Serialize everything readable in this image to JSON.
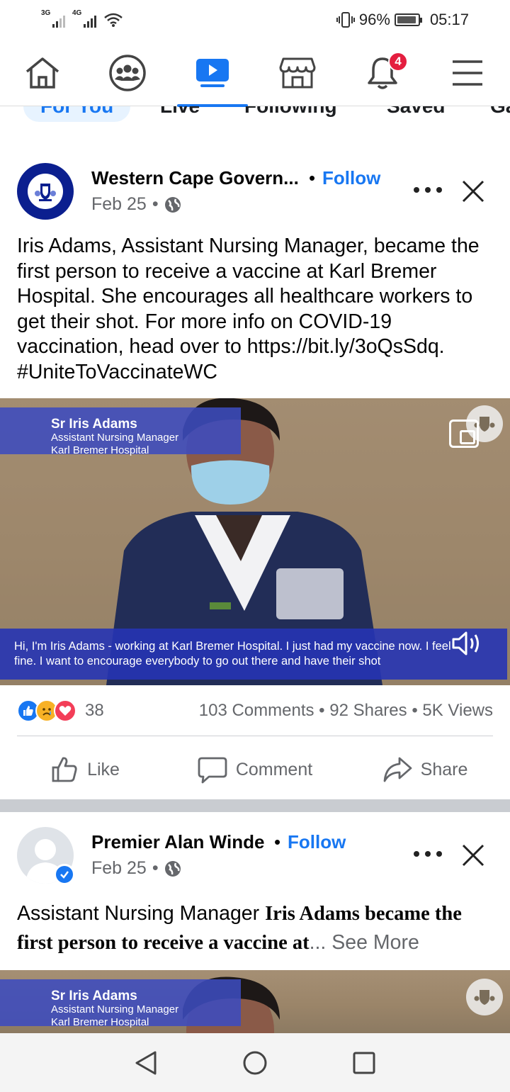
{
  "status_bar": {
    "signal1": "3G",
    "signal2": "4G",
    "battery": "96%",
    "time": "05:17"
  },
  "nav": {
    "notifications_badge": "4",
    "active": "watch"
  },
  "tabs": [
    "For You",
    "Live",
    "Following",
    "Saved",
    "Ga"
  ],
  "posts": [
    {
      "author": "Western Cape Govern...",
      "follow_sep": "•",
      "follow": "Follow",
      "date": "Feb 25",
      "meta_sep": "•",
      "text": "Iris Adams, Assistant Nursing Manager, became the first person to receive a vaccine at Karl Bremer Hospital. She encourages all healthcare workers to get their shot. For more info on COVID-19 vaccination, head over to https://bit.ly/3oQsSdq. #UniteToVaccinateWC",
      "video": {
        "lower_third_name": "Sr Iris Adams",
        "lower_third_title": "Assistant Nursing Manager",
        "lower_third_place": "Karl Bremer Hospital",
        "caption_line1": "Hi, I'm Iris Adams - working at Karl Bremer Hospital. I just had my vaccine now. I feel",
        "caption_line2": "fine. I want to encourage everybody to go out there and have their shot"
      },
      "reaction_count": "38",
      "engagement": "103 Comments • 92 Shares • 5K Views",
      "actions": {
        "like": "Like",
        "comment": "Comment",
        "share": "Share"
      }
    },
    {
      "author": "Premier Alan Winde",
      "follow_sep": "•",
      "follow": "Follow",
      "date": "Feb 25",
      "meta_sep": "•",
      "text_plain": "Assistant Nursing Manager ",
      "text_bold": "Iris Adams became the first person to receive a vaccine at",
      "see_more": "... See More",
      "video": {
        "lower_third_name": "Sr Iris Adams",
        "lower_third_title": "Assistant Nursing Manager",
        "lower_third_place": "Karl Bremer Hospital"
      }
    }
  ],
  "colors": {
    "brand": "#1877f2",
    "badge": "#e41e3f",
    "secondary_text": "#65676b",
    "gov_avatar": "#0b1f8f"
  }
}
